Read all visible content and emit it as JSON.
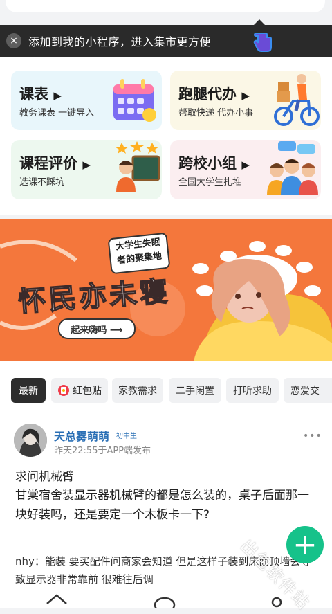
{
  "tip": {
    "close_icon": "×",
    "text": "添加到我的小程序，进入集市更方便"
  },
  "features": [
    {
      "title": "课表",
      "arrow": "▶",
      "subtitle": "教务课表 一键导入",
      "bg": "#e8f6fb"
    },
    {
      "title": "跑腿代办",
      "arrow": "▶",
      "subtitle": "帮取快递 代办小事",
      "bg": "#fbf7e6"
    },
    {
      "title": "课程评价",
      "arrow": "▶",
      "subtitle": "选课不踩坑",
      "bg": "#edf8ef"
    },
    {
      "title": "跨校小组",
      "arrow": "▶",
      "subtitle": "全国大学生扎堆",
      "bg": "#fbeef0"
    }
  ],
  "banner": {
    "bubble_line1": "大学生失眠",
    "bubble_line2": "者的聚集地",
    "headline": "怀民亦未寝",
    "cta": "起来嗨吗 ⟶",
    "bg": "#f4773c"
  },
  "tabs": [
    {
      "label": "最新",
      "active": true
    },
    {
      "label": "红包贴",
      "icon": "red-packet-icon"
    },
    {
      "label": "家教需求"
    },
    {
      "label": "二手闲置"
    },
    {
      "label": "打听求助"
    },
    {
      "label": "恋爱交"
    }
  ],
  "post": {
    "username": "天总雾萌萌",
    "badge": "初中生",
    "meta": "昨天22:55于APP端发布",
    "more_icon": "•••",
    "title": "求问机械臂",
    "body": "甘棠宿舍装显示器机械臂的都是怎么装的，桌子后面那一块好装吗，还是要定一个木板卡一下?",
    "comment": "nhy：能装 要买配件问商家会知道 但是这样子装到床面顶墙会导致显示器非常靠前 很难往后调"
  },
  "fab_icon": "+",
  "watermark": "出包软件站",
  "colors": {
    "accent_green": "#16c28a",
    "username_blue": "#2a6fb5",
    "banner_orange": "#f4773c"
  }
}
